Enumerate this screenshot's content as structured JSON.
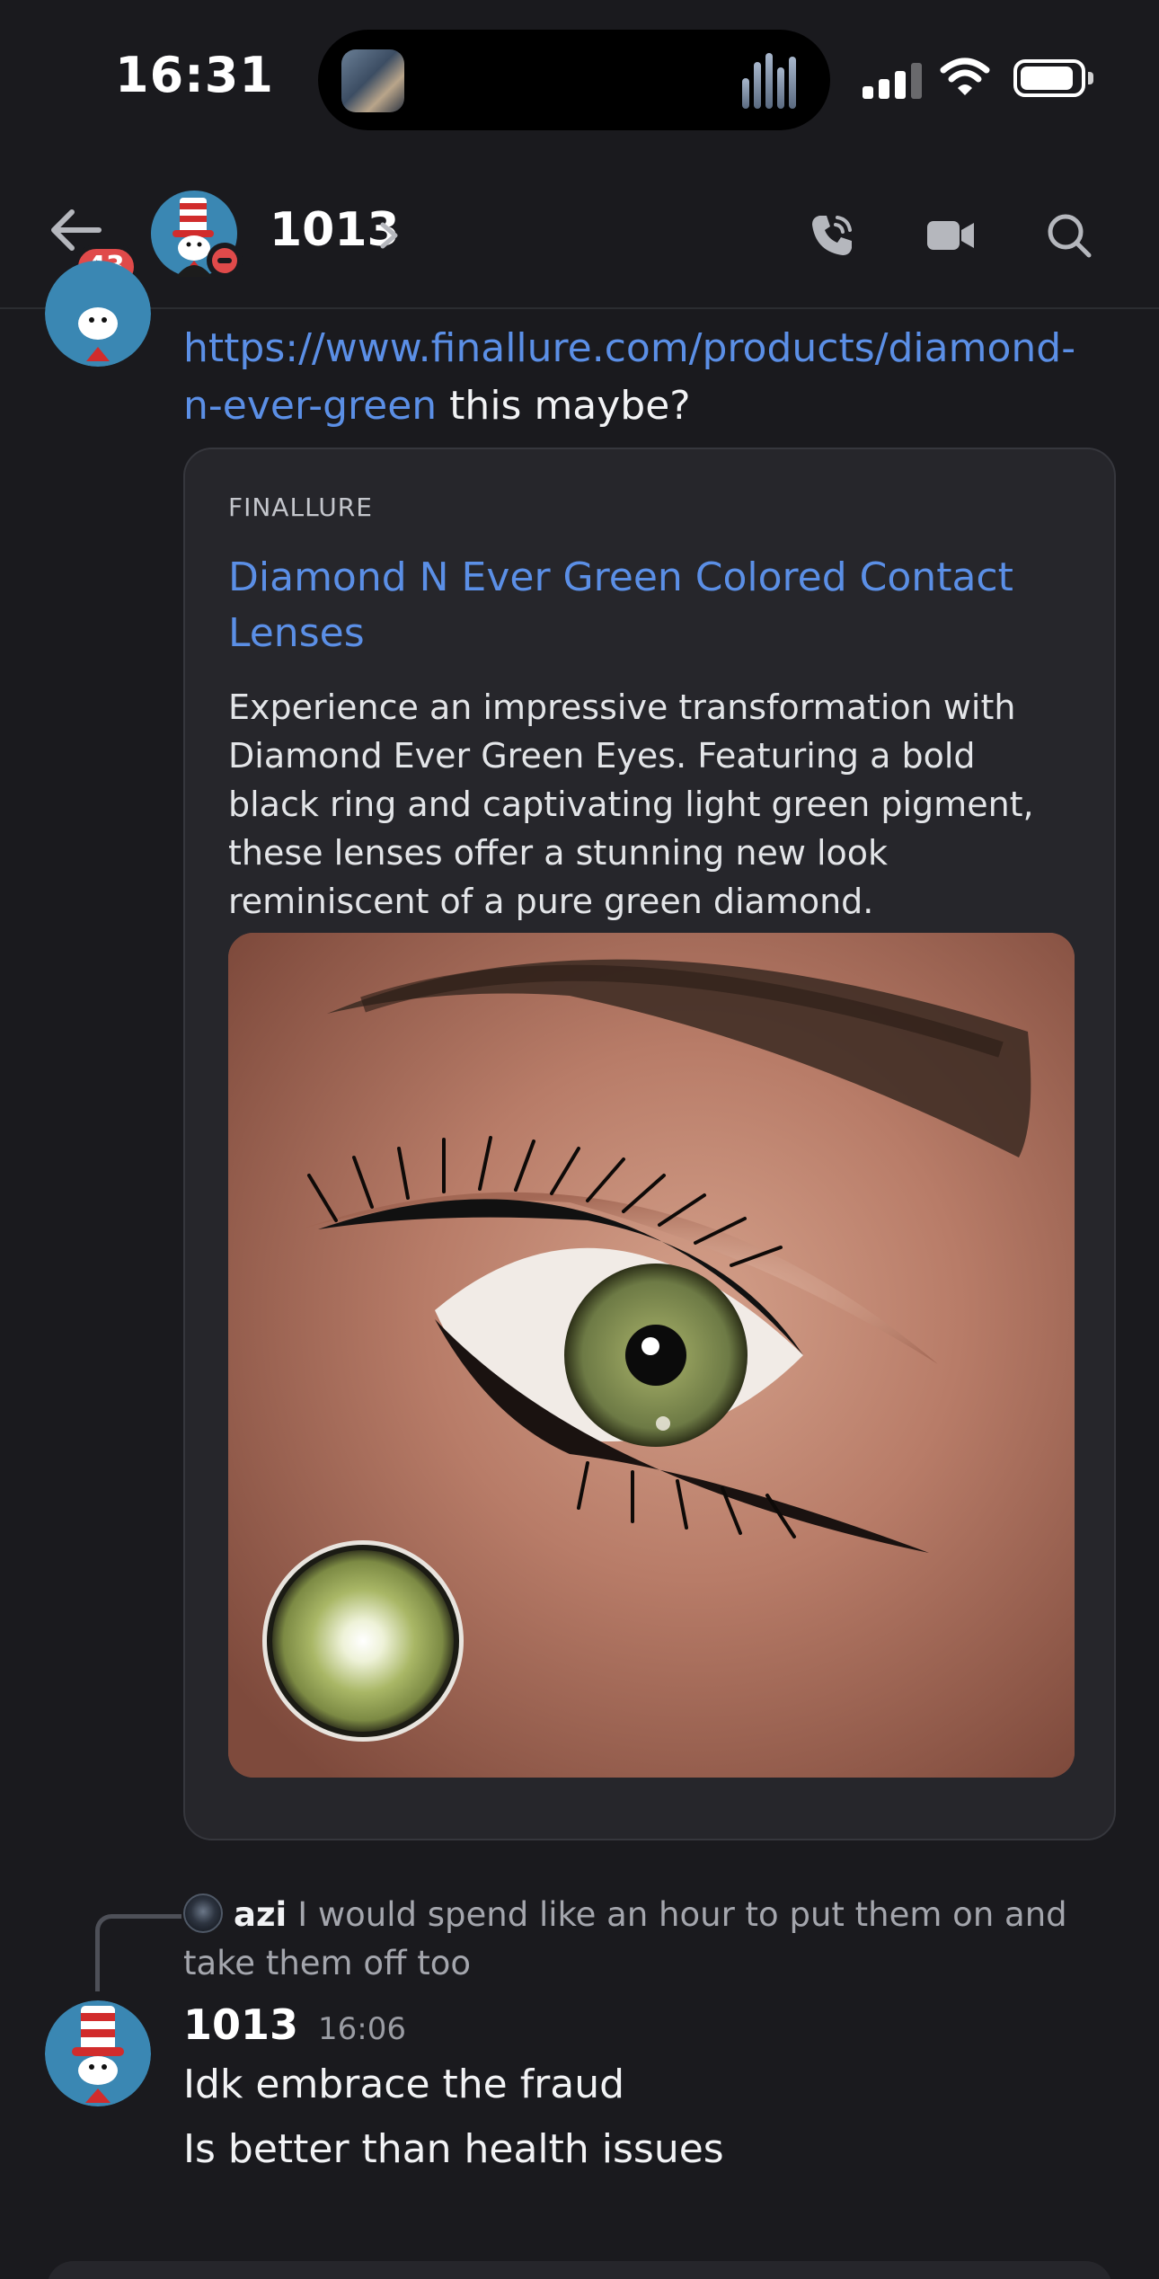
{
  "status_bar": {
    "time": "16:31",
    "icons": [
      "signal-icon",
      "wifi-icon",
      "battery-icon"
    ]
  },
  "header": {
    "unread_count": "43",
    "channel_name": "1013",
    "status": "do-not-disturb",
    "actions": [
      "phone-call-icon",
      "video-call-icon",
      "search-icon"
    ]
  },
  "messages": [
    {
      "link_url": "https://www.finallure.com/products/diamond-n-ever-green",
      "text_after_link": " this maybe?",
      "embed": {
        "provider": "FINALLURE",
        "title": "Diamond N Ever Green Colored Contact Lenses",
        "description": "Experience an impressive transformation with Diamond Ever Green Eyes. Featuring a bold black ring and captivating light green pigment, these lenses offer a stunning new look reminiscent of a pure green diamond."
      }
    },
    {
      "reply_to": {
        "author": "azi",
        "text": "I would spend like an hour to put them on and take them off too"
      },
      "author": "1013",
      "timestamp": "16:06",
      "lines": [
        "Idk embrace the fraud",
        "Is better than health issues"
      ]
    }
  ],
  "colors": {
    "background": "#1a1a1e",
    "link": "#5b8fe6",
    "embed_bg": "#26262b",
    "badge_red": "#e04a4a"
  }
}
